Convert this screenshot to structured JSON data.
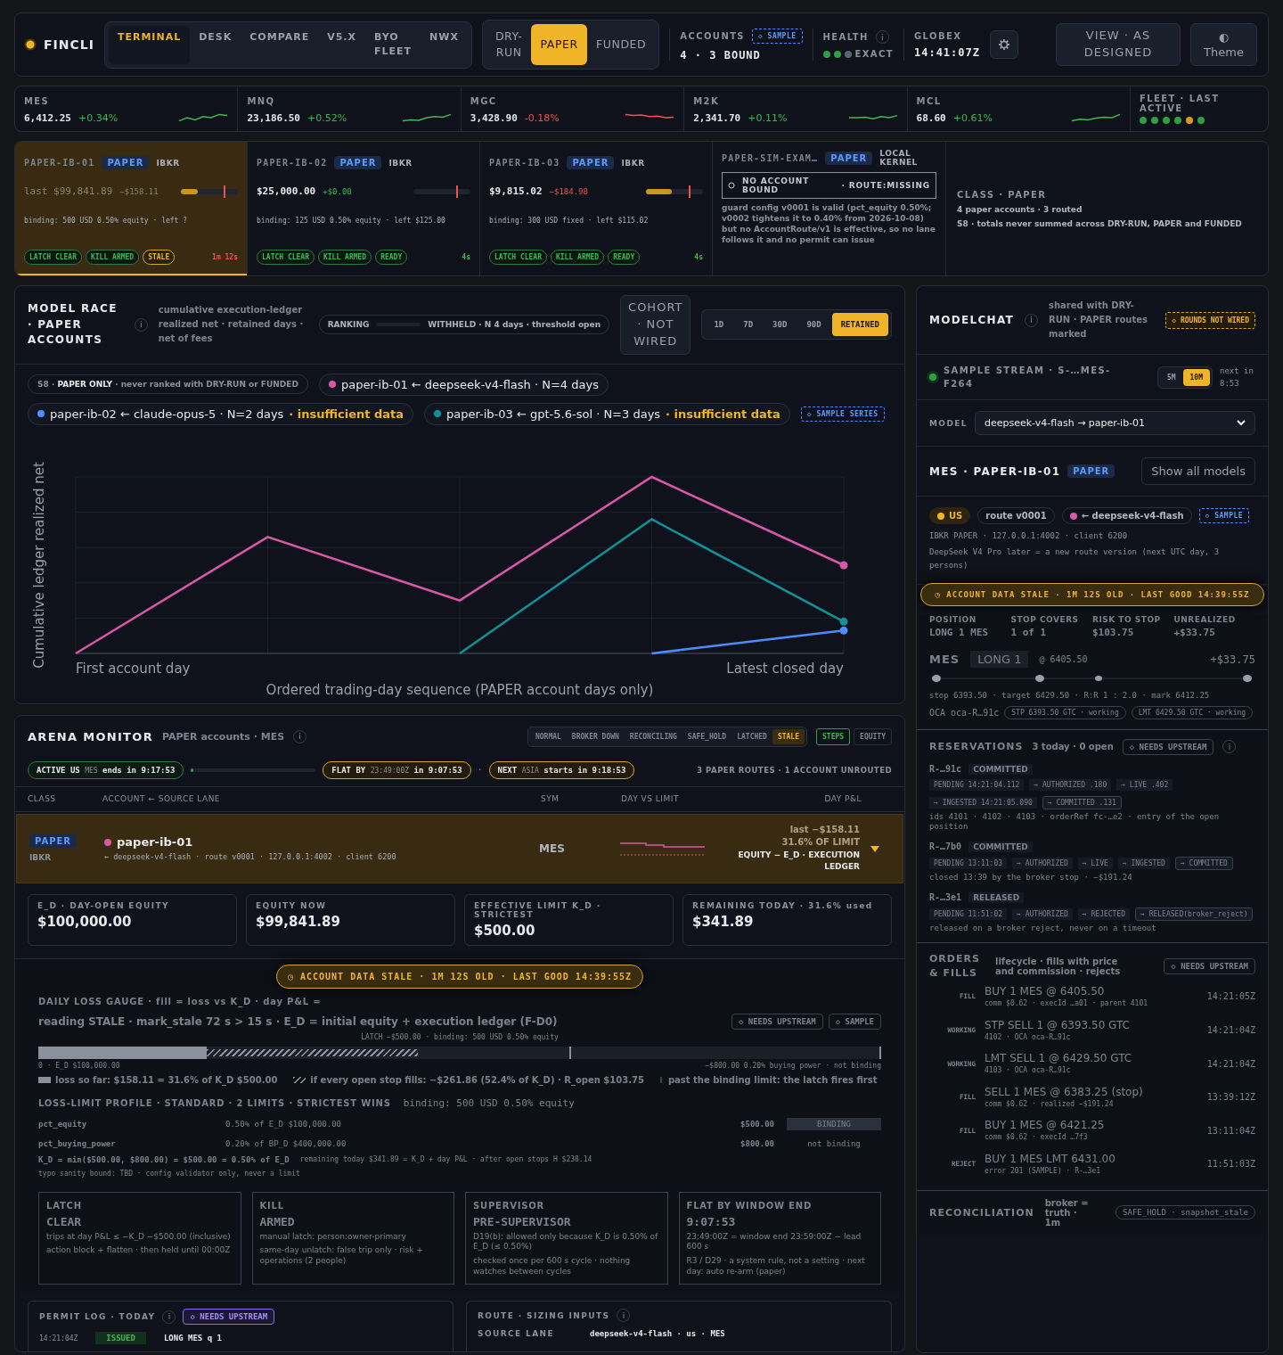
{
  "brand": {
    "name": "FINCLI"
  },
  "nav_tabs": [
    {
      "label": "TERMINAL",
      "selected": true
    },
    {
      "label": "DESK",
      "selected": false
    },
    {
      "label": "COMPARE",
      "selected": false
    },
    {
      "label": "V5.X",
      "selected": false
    },
    {
      "label": "BYO FLEET",
      "selected": false
    },
    {
      "label": "NWX",
      "selected": false
    }
  ],
  "mode_tabs": [
    {
      "label": "DRY-RUN",
      "selected": false
    },
    {
      "label": "PAPER",
      "selected": true
    },
    {
      "label": "FUNDED",
      "selected": false
    }
  ],
  "accounts": {
    "label": "ACCOUNTS",
    "badge": "◇ SAMPLE",
    "value": "4 · 3 BOUND"
  },
  "health": {
    "label": "HEALTH",
    "info": "i",
    "dots": [
      {
        "color": "#2ea043"
      },
      {
        "color": "#2ea043"
      },
      {
        "color": "#5c6370"
      }
    ],
    "status": "EXACT"
  },
  "globex": {
    "label": "GLOBEX",
    "time": "14:41:07Z"
  },
  "view_button": "VIEW · AS DESIGNED",
  "theme_button": {
    "icon": "◐",
    "label": "Theme"
  },
  "tickers": [
    {
      "symbol": "MES",
      "price": "6,412.25",
      "change": "+0.34%",
      "rising": true
    },
    {
      "symbol": "MNQ",
      "price": "23,186.50",
      "change": "+0.52%",
      "rising": true
    },
    {
      "symbol": "MGC",
      "price": "3,428.90",
      "change": "-0.18%",
      "rising": false
    },
    {
      "symbol": "M2K",
      "price": "2,341.70",
      "change": "+0.11%",
      "rising": true
    },
    {
      "symbol": "MCL",
      "price": "68.60",
      "change": "+0.61%",
      "rising": true
    }
  ],
  "fleet": {
    "label": "FLEET · LAST ACTIVE",
    "dots": [
      {
        "color": "#2ea043"
      },
      {
        "color": "#2ea043"
      },
      {
        "color": "#2ea043"
      },
      {
        "color": "#2ea043"
      },
      {
        "color": "#d99a22"
      },
      {
        "color": "#2ea043"
      }
    ]
  },
  "account_cards": [
    {
      "name": "PAPER-IB-01",
      "badge": "PAPER",
      "broker": "IBKR",
      "equity": "last $99,841.89",
      "pnl": "−$158.11",
      "loss": true,
      "level": 0.3,
      "binding": "binding: 500 USD 0.50% equity · left ?",
      "chips": [
        {
          "label": "LATCH CLEAR",
          "kind": "ok"
        },
        {
          "label": "KILL ARMED",
          "kind": "ok"
        },
        {
          "label": "STALE",
          "kind": "warn"
        }
      ],
      "age": "1m 12s",
      "stale": true,
      "selected": true
    },
    {
      "name": "PAPER-IB-02",
      "badge": "PAPER",
      "broker": "IBKR",
      "equity": "$25,000.00",
      "pnl": "+$0.00",
      "loss": false,
      "level": 0,
      "binding": "binding: 125 USD 0.50% equity · left $125.00",
      "chips": [
        {
          "label": "LATCH CLEAR",
          "kind": "ok"
        },
        {
          "label": "KILL ARMED",
          "kind": "ok"
        },
        {
          "label": "READY",
          "kind": "ok"
        }
      ],
      "age": "4s",
      "stale": false,
      "selected": false
    },
    {
      "name": "PAPER-IB-03",
      "badge": "PAPER",
      "broker": "IBKR",
      "equity": "$9,815.02",
      "pnl": "−$184.98",
      "loss": true,
      "level": 0.45,
      "binding": "binding: 300 USD fixed · left $115.02",
      "chips": [
        {
          "label": "LATCH CLEAR",
          "kind": "ok"
        },
        {
          "label": "KILL ARMED",
          "kind": "ok"
        },
        {
          "label": "READY",
          "kind": "ok"
        }
      ],
      "age": "4s",
      "stale": false,
      "selected": false
    }
  ],
  "unbound_card": {
    "name": "PAPER-SIM-EXAM…",
    "badge": "PAPER",
    "broker": "LOCAL KERNEL",
    "alert": "NO ACCOUNT BOUND",
    "alert_detail": "· ROUTE:MISSING",
    "note": "guard config v0001 is valid (pct_equity 0.50%; v0002 tightens it to 0.40% from 2026-10-08) but no AccountRoute/v1 is effective, so no lane follows it and no permit can issue"
  },
  "class_summary": {
    "title": "CLASS · PAPER",
    "lines": [
      "4 paper accounts · 3 routed",
      "S8 · totals never summed across DRY-RUN, PAPER and FUNDED"
    ]
  },
  "model_race": {
    "title": "MODEL RACE · PAPER ACCOUNTS",
    "info": "i",
    "subtitle": "cumulative execution-ledger realized net · retained days · net of fees",
    "ranking": {
      "label": "RANKING",
      "status": "WITHHELD · N 4 days · threshold open"
    },
    "cohort_button": "COHORT · NOT WIRED",
    "ranges": [
      {
        "label": "1D",
        "selected": false
      },
      {
        "label": "7D",
        "selected": false
      },
      {
        "label": "30D",
        "selected": false
      },
      {
        "label": "90D",
        "selected": false
      },
      {
        "label": "RETAINED",
        "selected": true
      }
    ],
    "scope_note": "S8 · **PAPER ONLY** · never ranked with DRY-RUN or FUNDED",
    "series": [
      {
        "label": "paper-ib-01 ← deepseek-v4-flash · N=4 days",
        "color": "#d957a8"
      },
      {
        "label": "paper-ib-02 ← claude-opus-5 · N=2 days",
        "color": "#4c8dff",
        "warning": "· insufficient data"
      },
      {
        "label": "paper-ib-03 ← gpt-5.6-sol · N=3 days",
        "color": "#12919a",
        "warning": "· insufficient data"
      }
    ],
    "sample_badge": "◇ SAMPLE SERIES",
    "chart": {
      "ylabel": "Cumulative ledger realized net",
      "x_start": "First account day",
      "x_end": "Latest closed day",
      "xlabel": "Ordered trading-day sequence (PAPER account days only)"
    }
  },
  "arena": {
    "title": "ARENA MONITOR",
    "subtitle": "PAPER accounts · MES",
    "info": "i",
    "states": [
      {
        "label": "NORMAL",
        "selected": false
      },
      {
        "label": "BROKER DOWN",
        "selected": false
      },
      {
        "label": "RECONCILING",
        "selected": false
      },
      {
        "label": "SAFE_HOLD",
        "selected": false
      },
      {
        "label": "LATCHED",
        "selected": false
      },
      {
        "label": "STALE",
        "selected": true
      }
    ],
    "views": [
      {
        "label": "STEPS",
        "selected": true
      },
      {
        "label": "EQUITY",
        "selected": false
      }
    ],
    "session": {
      "active": {
        "label": "ACTIVE US",
        "tag": "MES",
        "text": "ends in 9:17:53"
      },
      "level": 0.02,
      "flat": {
        "label": "FLAT BY",
        "tag": "23:49:00Z",
        "text": "in 9:07:53"
      },
      "separator": "·",
      "next": {
        "label": "NEXT",
        "tag": "ASIA",
        "text": "starts in 9:18:53"
      },
      "summary": "3 PAPER ROUTES · 1 ACCOUNT UNROUTED"
    },
    "columns": [
      "CLASS",
      "ACCOUNT ← SOURCE LANE",
      "SYM",
      "DAY VS LIMIT",
      "DAY P&L"
    ],
    "rows": [
      {
        "class": "PAPER",
        "broker": "IBKR",
        "color": "#d957a8",
        "account": "paper-ib-01",
        "lane": "← deepseek-v4-flash · route v0001 · 127.0.0.1:4002 · client 6200",
        "symbol": "MES",
        "pnl": "last −$158.11",
        "limit": "31.6% OF LIMIT",
        "source": "EQUITY − E_D · EXECUTION LEDGER",
        "expanded": true,
        "selected": true
      }
    ],
    "metrics": [
      {
        "label": "E_D · DAY-OPEN EQUITY",
        "value": "$100,000.00"
      },
      {
        "label": "EQUITY NOW",
        "value": "$99,841.89"
      },
      {
        "label": "EFFECTIVE LIMIT K_D · STRICTEST",
        "value": "$500.00"
      },
      {
        "label": "REMAINING TODAY · 31.6% used",
        "value": "$341.89"
      }
    ],
    "stale_banner": "◷ ACCOUNT DATA STALE · 1M 12S OLD · LAST GOOD 14:39:55Z",
    "details": {
      "dimmed": true,
      "gauge": {
        "title": "DAILY LOSS GAUGE · fill = loss vs K_D · day P&L =",
        "reading": "reading STALE · mark_stale 72 s > 15 s · E_D = initial equity + execution ledger (F-D0)",
        "badges": [
          "◇ NEEDS UPSTREAM",
          "◇ SAMPLE"
        ],
        "latch_label": "LATCH −$500.00 · binding: 500 USD 0.50% equity",
        "level": 0.2,
        "axis_start": "0 · E_D $100,000.00",
        "axis_end": "−$800.00 0.20% buying power · not binding",
        "legend": [
          {
            "kind": "solid",
            "text": "loss so far: $158.11 = 31.6% of K_D $500.00"
          },
          {
            "kind": "hatched",
            "text": "if every open stop fills: −$261.86 (52.4% of K_D) · R_open $103.75"
          },
          {
            "kind": "line",
            "text": "past the binding limit: the latch fires first"
          }
        ]
      },
      "profile": {
        "title": "LOSS-LIMIT PROFILE · STANDARD · 2 LIMITS · STRICTEST WINS",
        "binding": "binding: 500 USD 0.50% equity",
        "limits": [
          {
            "name": "pct_equity",
            "basis": "0.50% of E_D $100,000.00",
            "amount": "$500.00",
            "status": "BINDING",
            "binding": true
          },
          {
            "name": "pct_buying_power",
            "basis": "0.20% of BP_D $400,000.00",
            "amount": "$800.00",
            "status": "not binding",
            "binding": false
          }
        ],
        "formula": "K_D = min($500.00, $800.00) = $500.00 = 0.50% of E_D",
        "remaining": "remaining today $341.89 = K_D + day P&L · after open stops H $238.14",
        "sanity": "typo sanity bound: TBD · config validator only, never a limit"
      },
      "status_cards": [
        {
          "label": "LATCH",
          "value": "CLEAR",
          "lines": [
            "trips at day P&L ≤ −K_D −$500.00 (inclusive)",
            "action block + flatten · then held until 00:00Z"
          ]
        },
        {
          "label": "KILL",
          "value": "ARMED",
          "lines": [
            "manual latch: person:owner-primary",
            "same-day unlatch: false trip only · risk + operations (2 people)"
          ]
        },
        {
          "label": "SUPERVISOR",
          "value": "PRE-SUPERVISOR",
          "lines": [
            "D19(b): allowed only because K_D is 0.50% of E_D (≤ 0.50%)",
            "checked once per 600 s cycle · nothing watches between cycles"
          ]
        },
        {
          "label": "FLAT BY WINDOW END",
          "value": "9:07:53",
          "lines": [
            "23:49:00Z = window end 23:59:00Z − lead 600 s",
            "R3 / D29 · a system rule, not a setting · next day: auto re-arm (paper)"
          ]
        }
      ]
    },
    "permit_log": {
      "title": "PERMIT LOG · TODAY",
      "info": "i",
      "badge": "◇ NEEDS UPSTREAM",
      "entries": [
        {
          "time": "14:21:04Z",
          "status": "ISSUED",
          "text": "LONG MES q 1"
        }
      ]
    },
    "route_inputs": {
      "title": "ROUTE · SIZING INPUTS",
      "info": "i",
      "rows": [
        {
          "label": "SOURCE LANE",
          "value": "deepseek-v4-flash · us · MES"
        }
      ]
    }
  },
  "modelchat": {
    "title": "MODELCHAT",
    "info": "i",
    "subtitle": "shared with DRY-RUN · PAPER routes marked",
    "badge": "◇ ROUNDS NOT WIRED",
    "stream": {
      "color": "#2ea043",
      "label": "SAMPLE STREAM · S-…MES-F264",
      "intervals": [
        {
          "label": "5M",
          "selected": false
        },
        {
          "label": "10M",
          "selected": true
        }
      ],
      "next": "next in 8:53"
    },
    "model": {
      "label": "MODEL",
      "value": "deepseek-v4-flash → paper-ib-01"
    },
    "focus": {
      "title": "MES · PAPER-IB-01",
      "badge": "PAPER",
      "button": "Show all models"
    },
    "chips": [
      {
        "kind": "session",
        "label": "US",
        "color": "#f0b429"
      },
      {
        "kind": "plain",
        "label": "route v0001"
      },
      {
        "kind": "lane",
        "label": "← deepseek-v4-flash",
        "color": "#d957a8"
      },
      {
        "kind": "sample",
        "label": "◇ SAMPLE"
      }
    ],
    "connection": "IBKR PAPER · 127.0.0.1:4002 · client 6200",
    "note": "DeepSeek V4 Pro later = a new route version (next UTC day, 3 persons)",
    "stale_banner": "◷ ACCOUNT DATA STALE · 1M 12S OLD · LAST GOOD 14:39:55Z",
    "details": {
      "dimmed": true,
      "position_stats": [
        {
          "label": "POSITION",
          "value": "LONG 1 MES"
        },
        {
          "label": "STOP COVERS",
          "value": "1 of 1"
        },
        {
          "label": "RISK TO STOP",
          "value": "$103.75"
        },
        {
          "label": "UNREALIZED",
          "value": "+$33.75"
        }
      ],
      "position": {
        "symbol": "MES",
        "side": "LONG 1",
        "entry": "@ 6405.50",
        "pnl": "+$33.75",
        "levels": "stop 6393.50 · target 6429.50 · R:R 1 : 2.0 · mark 6412.25",
        "oca": "OCA oca-R…91c",
        "orders": [
          "STP 6393.50 GTC · working",
          "LMT 6429.50 GTC · working"
        ]
      },
      "reservations": {
        "title": "RESERVATIONS",
        "summary": "3 today · 0 open",
        "badge": "◇ NEEDS UPSTREAM",
        "info": "i",
        "items": [
          {
            "id": "R-…91c",
            "state": "COMMITTED",
            "steps": [
              {
                "label": "PENDING 14:21:04.112",
                "current": false
              },
              {
                "label": "→ AUTHORIZED .180",
                "current": false
              },
              {
                "label": "→ LIVE .402",
                "current": false
              },
              {
                "label": "→ INGESTED 14:21:05.090",
                "current": false
              },
              {
                "label": "→ COMMITTED .131",
                "current": true
              }
            ],
            "note": "ids 4101 · 4102 · 4103 · orderRef fc-…e2 · entry of the open position"
          },
          {
            "id": "R-…7b0",
            "state": "COMMITTED",
            "steps": [
              {
                "label": "PENDING 13:11:03",
                "current": false
              },
              {
                "label": "→ AUTHORIZED",
                "current": false
              },
              {
                "label": "→ LIVE",
                "current": false
              },
              {
                "label": "→ INGESTED",
                "current": false
              },
              {
                "label": "→ COMMITTED",
                "current": true
              }
            ],
            "note": "closed 13:39 by the broker stop · −$191.24"
          },
          {
            "id": "R-…3e1",
            "state": "RELEASED",
            "steps": [
              {
                "label": "PENDING 11:51:02",
                "current": false
              },
              {
                "label": "→ AUTHORIZED",
                "current": false
              },
              {
                "label": "→ REJECTED",
                "current": false
              },
              {
                "label": "→ RELEASED(broker_reject)",
                "current": true
              }
            ],
            "note": "released on a broker reject, never on a timeout"
          }
        ]
      },
      "orders": {
        "title": "ORDERS & FILLS",
        "subtitle": "lifecycle · fills with price and commission · rejects",
        "badge": "◇ NEEDS UPSTREAM",
        "rows": [
          {
            "status": "FILL",
            "title": "BUY 1 MES @ 6405.50",
            "detail": "comm $0.62 · execId …a01 · parent 4101",
            "time": "14:21:05Z"
          },
          {
            "status": "WORKING",
            "title": "STP SELL 1 @ 6393.50 GTC",
            "detail": "4102 · OCA oca-R…91c",
            "time": "14:21:04Z"
          },
          {
            "status": "WORKING",
            "title": "LMT SELL 1 @ 6429.50 GTC",
            "detail": "4103 · OCA oca-R…91c",
            "time": "14:21:04Z"
          },
          {
            "status": "FILL",
            "title": "SELL 1 MES @ 6383.25 (stop)",
            "detail": "comm $0.62 · realized −$191.24",
            "time": "13:39:12Z"
          },
          {
            "status": "FILL",
            "title": "BUY 1 MES @ 6421.25",
            "detail": "comm $0.62 · execId …7f3",
            "time": "13:11:04Z"
          },
          {
            "status": "REJECT",
            "title": "BUY 1 MES LMT 6431.00",
            "detail": "error 201 (SAMPLE) · R-…3e1",
            "time": "11:51:03Z"
          }
        ]
      },
      "reconciliation": {
        "title": "RECONCILIATION",
        "subtitle": "broker = truth · 1m",
        "status": "SAFE_HOLD · snapshot_stale"
      }
    }
  }
}
